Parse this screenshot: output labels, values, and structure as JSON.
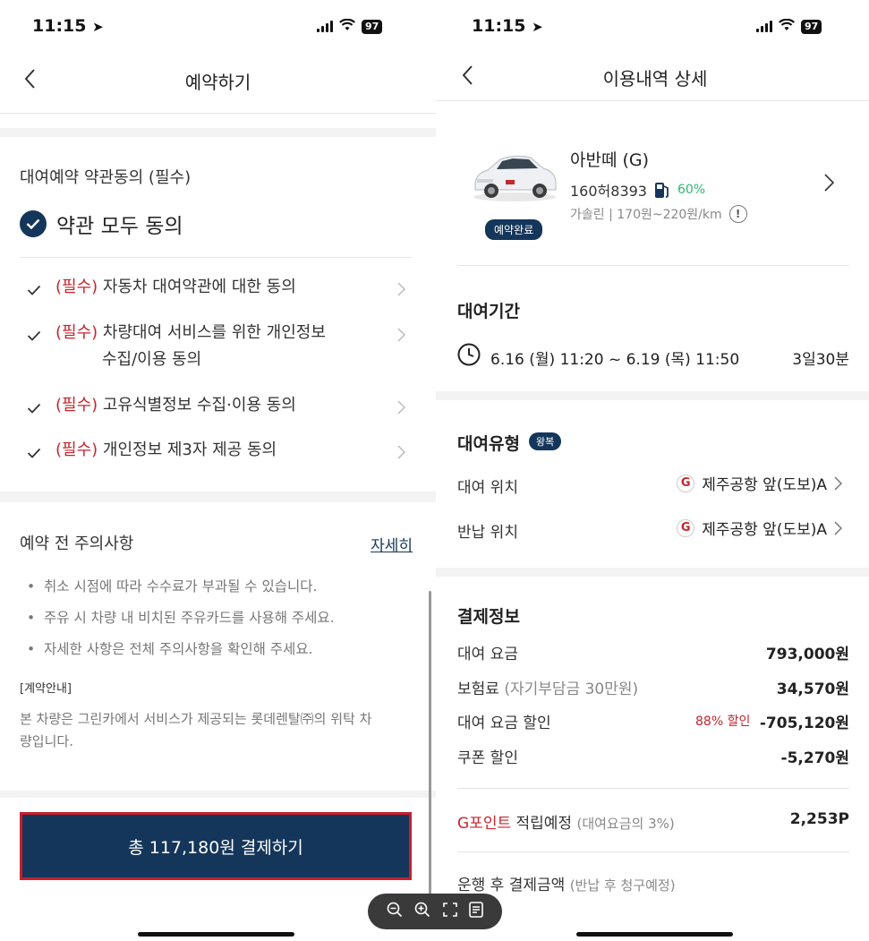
{
  "status": {
    "time": "11:15",
    "battery": "97"
  },
  "left": {
    "nav_title": "예약하기",
    "terms_section_title": "대여예약 약관동의 (필수)",
    "agree_all": "약관 모두 동의",
    "items": [
      {
        "tag": "(필수)",
        "text": "자동차 대여약관에 대한 동의",
        "text2": ""
      },
      {
        "tag": "(필수)",
        "text": "차량대여 서비스를 위한 개인정보",
        "text2": "수집/이용 동의"
      },
      {
        "tag": "(필수)",
        "text": "고유식별정보 수집·이용 동의",
        "text2": ""
      },
      {
        "tag": "(필수)",
        "text": "개인정보 제3자 제공 동의",
        "text2": ""
      }
    ],
    "notice_title": "예약 전 주의사항",
    "notice_link": "자세히",
    "notices": [
      "취소 시점에 따라 수수료가 부과될 수 있습니다.",
      "주유 시 차량 내 비치된 주유카드를 사용해 주세요.",
      "자세한 사항은 전체 주의사항을 확인해 주세요."
    ],
    "contract_label": "[계약안내]",
    "contract_text_1": "본 차량은 그린카에서 서비스가 제공되는 롯데렌탈㈜의 위탁 차",
    "contract_text_2": "량입니다.",
    "pay_button": "총 117,180원 결제하기"
  },
  "right": {
    "nav_title": "이용내역 상세",
    "car_name": "아반떼 (G)",
    "plate": "160허8393",
    "fuel_level": "60%",
    "fuel_info": "가솔린 | 170원~220원/km",
    "status_badge": "예약완료",
    "period_title": "대여기간",
    "period": "6.16 (월) 11:20 ~ 6.19 (목) 11:50",
    "duration": "3일30분",
    "type_title": "대여유형",
    "type_badge": "왕복",
    "pickup_label": "대여 위치",
    "pickup_value": "제주공항 앞(도보)A",
    "return_label": "반납 위치",
    "return_value": "제주공항 앞(도보)A",
    "payment_title": "결제정보",
    "rows": [
      {
        "label": "대여 요금",
        "sub": "",
        "extra": "",
        "value": "793,000원"
      },
      {
        "label": "보험료",
        "sub": "(자기부담금 30만원)",
        "extra": "",
        "value": "34,570원"
      },
      {
        "label": "대여 요금 할인",
        "sub": "",
        "extra": "88% 할인",
        "value": "-705,120원"
      },
      {
        "label": "쿠폰 할인",
        "sub": "",
        "extra": "",
        "value": "-5,270원"
      }
    ],
    "gpoint_brand": "G포인트",
    "gpoint_label": "적립예정",
    "gpoint_sub": "(대여요금의 3%)",
    "gpoint_value": "2,253P",
    "after_label": "운행 후 결제금액",
    "after_sub": "(반납 후 청구예정)"
  },
  "colors": {
    "navy": "#14365a",
    "red": "#c4262e",
    "green": "#2bb673"
  }
}
